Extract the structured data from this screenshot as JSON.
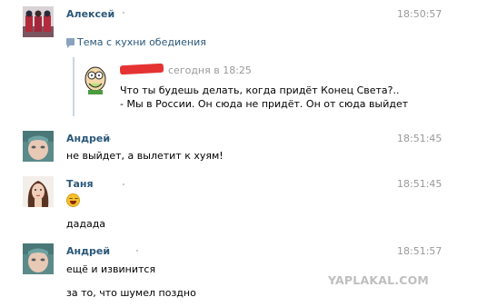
{
  "messages": [
    {
      "author": "Алексей",
      "time": "18:50:57",
      "repost": {
        "label": "Тема с кухни обедиения",
        "date": "сегодня в 18:25",
        "lines": [
          "Что ты будешь делать, когда придёт Конец Света?..",
          "- Мы в России. Он сюда не придёт. Он от сюда выйдет"
        ]
      }
    },
    {
      "author": "Андрей",
      "time": "18:51:45",
      "lines": [
        "не выйдет, а вылетит к хуям!"
      ]
    },
    {
      "author": "Таня",
      "time": "18:51:45",
      "emoji": "laughing-emoji-icon",
      "lines": [
        "дадада"
      ]
    },
    {
      "author": "Андрей",
      "time": "18:51:57",
      "lines": [
        "ещё и извинится",
        "за то, что шумел поздно"
      ]
    }
  ],
  "watermark": "YAPLAKAL.COM",
  "colors": {
    "author_link": "#2b587a",
    "timestamp": "#999999",
    "quote_bar": "#c9d6e2",
    "redaction": "#e53333",
    "watermark": "#bfbfbf"
  }
}
